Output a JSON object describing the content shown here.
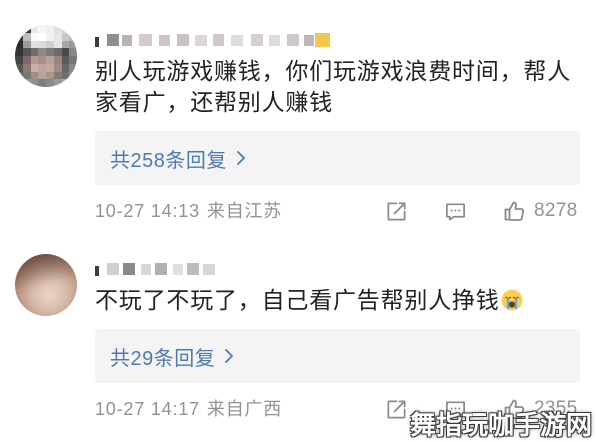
{
  "theme": {
    "text": "#222222",
    "meta": "#929292",
    "link": "#4f7ab0",
    "reply_bg": "#f4f4f4",
    "icon": "#8a8a8a",
    "watermark_fill": "#ffffff",
    "watermark_stroke": "#3a3a3a"
  },
  "icons": {
    "share": "share-icon",
    "comment": "comment-icon",
    "like": "thumbs-up-icon",
    "reply_chevron": "chevron-right-icon"
  },
  "comments": [
    {
      "text_lines": [
        "别人玩游戏赚钱，你们玩游戏浪费时间，帮人",
        "家看广，还帮别人赚钱"
      ],
      "reply_label": "共258条回复",
      "time": "10-27 14:13",
      "location": "来自江苏",
      "likes": "8278"
    },
    {
      "text_lines": [
        "不玩了不玩了，自己看广告帮别人挣钱"
      ],
      "emoji_icon": "loudly-crying-face-icon",
      "reply_label": "共29条回复",
      "time": "10-27 14:17",
      "location": "来自广西",
      "likes": "2355"
    }
  ],
  "watermark": "舞指玩咖手游网"
}
